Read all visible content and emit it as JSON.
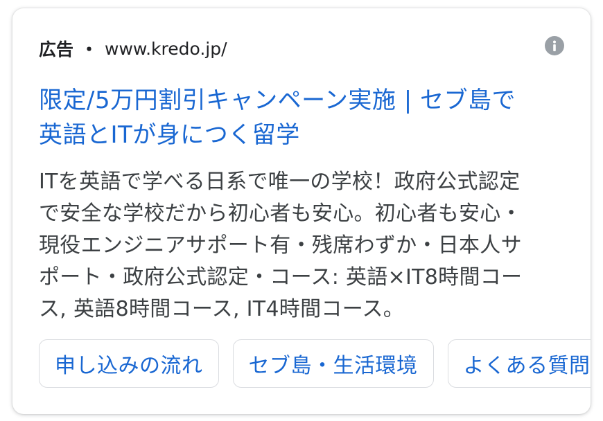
{
  "ad": {
    "label": "広告",
    "separator": "・",
    "url": "www.kredo.jp/",
    "info_icon": "info-icon",
    "headline_line1": "限定/5万円割引キャンペーン実施 | セブ島で",
    "headline_line2": "英語とITが身につく留学",
    "description": [
      "ITを英語で学べる日系で唯一の学校！政府公式認定",
      "で安全な学校だから初心者も安心。初心者も安心・",
      "現役エンジニアサポート有・残席わずか・日本人サ",
      "ポート・政府公式認定・コース: 英語×IT8時間コー",
      "ス, 英語8時間コース, IT4時間コース。"
    ],
    "sitelinks": [
      "申し込みの流れ",
      "セブ島・生活環境",
      "よくある質問"
    ]
  },
  "colors": {
    "link": "#1967d2",
    "text": "#3c4043",
    "label": "#202124",
    "icon": "#9aa0a6",
    "border": "#dadce0"
  }
}
